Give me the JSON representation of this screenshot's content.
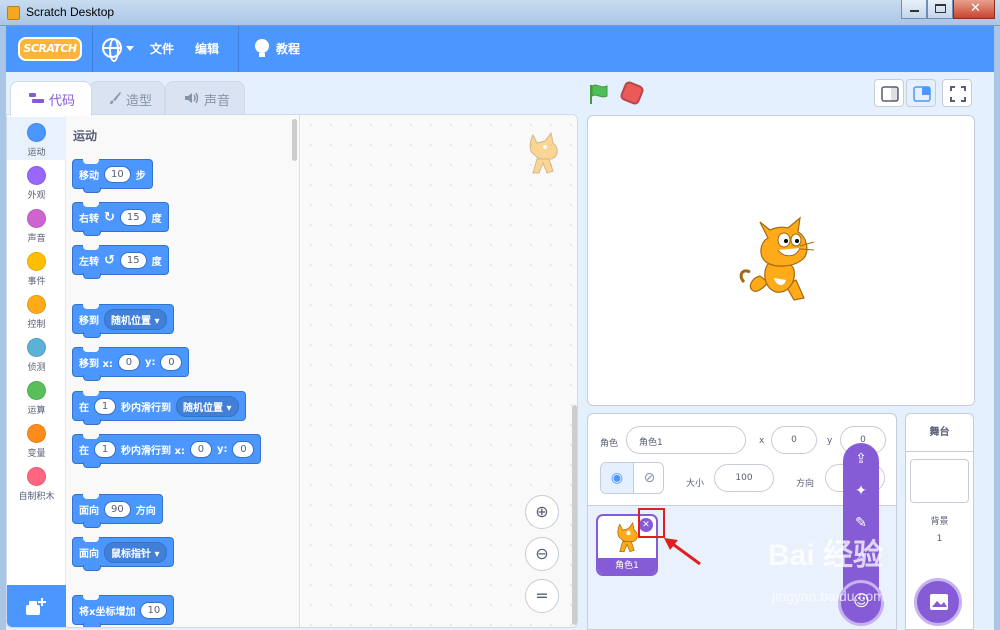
{
  "window": {
    "title": "Scratch Desktop"
  },
  "menubar": {
    "logo": "SCRATCH",
    "file": "文件",
    "edit": "编辑",
    "tutorials": "教程"
  },
  "tabs": [
    {
      "label": "代码"
    },
    {
      "label": "造型"
    },
    {
      "label": "声音"
    }
  ],
  "categories": [
    {
      "label": "运动",
      "color": "#4c97ff"
    },
    {
      "label": "外观",
      "color": "#9966ff"
    },
    {
      "label": "声音",
      "color": "#cf63cf"
    },
    {
      "label": "事件",
      "color": "#ffbf00"
    },
    {
      "label": "控制",
      "color": "#ffab19"
    },
    {
      "label": "侦测",
      "color": "#5cb1d6"
    },
    {
      "label": "运算",
      "color": "#59c059"
    },
    {
      "label": "变量",
      "color": "#ff8c1a"
    },
    {
      "label": "自制积木",
      "color": "#ff6680"
    }
  ],
  "palette": {
    "heading": "运动",
    "move": {
      "a": "移动",
      "n": "10",
      "b": "步"
    },
    "turn_right": {
      "a": "右转",
      "n": "15",
      "b": "度"
    },
    "turn_left": {
      "a": "左转",
      "n": "15",
      "b": "度"
    },
    "goto": {
      "a": "移到",
      "dd": "随机位置"
    },
    "goto_xy": {
      "a": "移到 x:",
      "x": "0",
      "b": "y:",
      "y": "0"
    },
    "glide": {
      "a": "在",
      "n": "1",
      "b": "秒内滑行到",
      "dd": "随机位置"
    },
    "glide_xy": {
      "a": "在",
      "n": "1",
      "b": "秒内滑行到 x:",
      "x": "0",
      "c": "y:",
      "y": "0"
    },
    "point": {
      "a": "面向",
      "n": "90",
      "b": "方向"
    },
    "point_towards": {
      "a": "面向",
      "dd": "鼠标指针"
    },
    "change_x": {
      "a": "将x坐标增加",
      "n": "10"
    }
  },
  "sprite_info": {
    "sprite_label": "角色",
    "sprite_name": "角色1",
    "x_label": "x",
    "x_value": "0",
    "y_label": "y",
    "y_value": "0",
    "size_label": "大小",
    "size_value": "100",
    "direction_label": "方向"
  },
  "sprites": [
    {
      "name": "角色1"
    }
  ],
  "stage_pane": {
    "title": "舞台",
    "backdrop_label": "背景",
    "backdrop_count": "1"
  },
  "watermark": {
    "main": "Bai 经验",
    "url": "jingyan.baidu.com"
  },
  "colors": {
    "accent": "#4c97ff",
    "sprite_accent": "#855cd6",
    "highlight": "#e02020"
  }
}
